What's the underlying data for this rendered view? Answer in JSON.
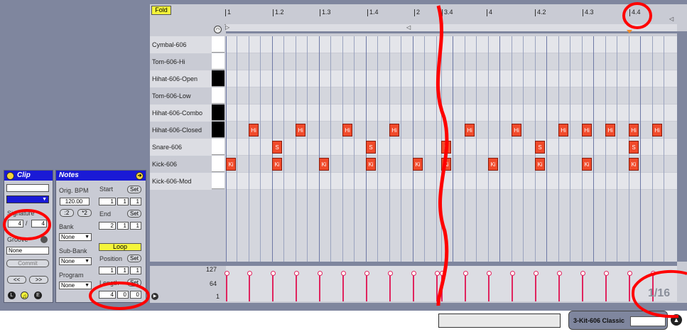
{
  "clip_panel": {
    "title": "Clip",
    "signature_label": "Signature",
    "sig_num": "4",
    "sig_slash": "/",
    "sig_den": "4",
    "groove_label": "Groove",
    "groove_value": "None",
    "commit_label": "Commit",
    "nav_prev": "<<",
    "nav_next": ">>",
    "mode_l": "L",
    "mode_e": "E"
  },
  "notes_panel": {
    "title": "Notes",
    "orig_bpm_label": "Orig. BPM",
    "orig_bpm_value": "120.00",
    "half_label": ":2",
    "double_label": "*2",
    "bank_label": "Bank",
    "bank_value": "None",
    "subbank_label": "Sub-Bank",
    "subbank_value": "None",
    "program_label": "Program",
    "program_value": "None",
    "start_label": "Start",
    "start_values": [
      "1",
      "1",
      "1"
    ],
    "end_label": "End",
    "end_values": [
      "2",
      "1",
      "1"
    ],
    "loop_label": "Loop",
    "position_label": "Position",
    "position_values": [
      "1",
      "1",
      "1"
    ],
    "length_label": "Length",
    "length_values": [
      "4",
      "0",
      "0"
    ],
    "set_label": "Set"
  },
  "editor": {
    "fold_label": "Fold",
    "ruler_ticks": [
      "1",
      "1.2",
      "1.3",
      "1.4",
      "2",
      "3.4",
      "4",
      "4.2",
      "4.3",
      "4.4"
    ],
    "rows": [
      {
        "name": "Cymbal-606",
        "key": "white"
      },
      {
        "name": "Tom-606-Hi",
        "key": "white"
      },
      {
        "name": "Hihat-606-Open",
        "key": "black"
      },
      {
        "name": "Tom-606-Low",
        "key": "white"
      },
      {
        "name": "Hihat-606-Combo",
        "key": "black"
      },
      {
        "name": "Hihat-606-Closed",
        "key": "black"
      },
      {
        "name": "Snare-606",
        "key": "white"
      },
      {
        "name": "Kick-606",
        "key": "white"
      },
      {
        "name": "Kick-606-Mod",
        "key": "white"
      }
    ],
    "hi_label": "Hi",
    "snare_label": "S",
    "kick_label": "Ki",
    "velocity_ticks": [
      "127",
      "64",
      "1"
    ],
    "grid_label": "1/16"
  },
  "status": {
    "device_name": "3-Kit-606 Classic"
  },
  "colors": {
    "panel_bg": "#7f869e",
    "note": "#f04a2a",
    "velocity": "#e0245e",
    "title_bar": "#1a1ad6",
    "loop": "#f5f53a",
    "annotation": "#ff0000"
  }
}
